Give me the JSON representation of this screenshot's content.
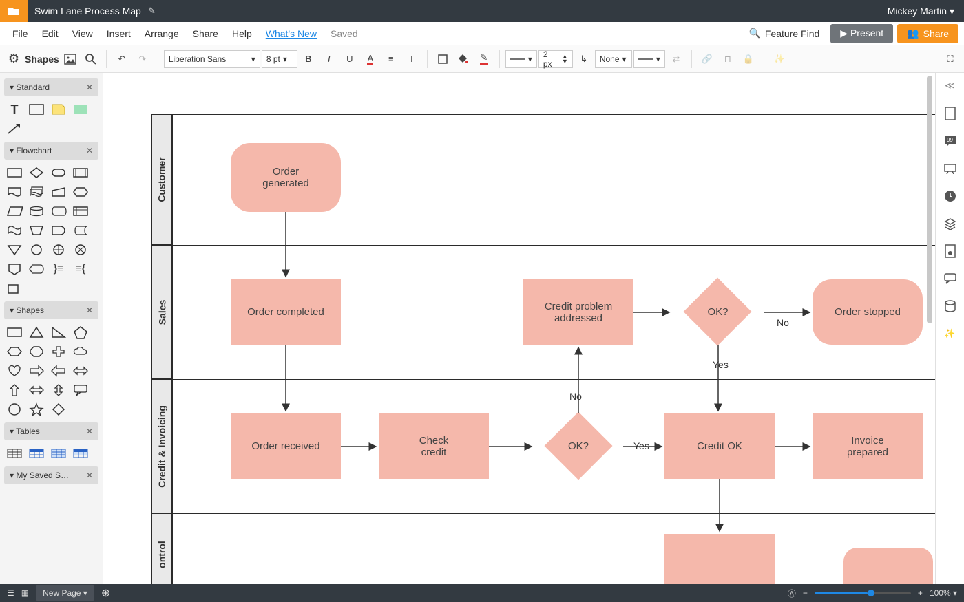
{
  "titlebar": {
    "doc_title": "Swim Lane Process Map",
    "user": "Mickey Martin ▾"
  },
  "menu": {
    "file": "File",
    "edit": "Edit",
    "view": "View",
    "insert": "Insert",
    "arrange": "Arrange",
    "share": "Share",
    "help": "Help",
    "whats_new": "What's New",
    "saved": "Saved",
    "feature_find": "Feature Find",
    "present": "▶ Present",
    "share_btn": "Share"
  },
  "toolbar": {
    "shapes": "Shapes",
    "font": "Liberation Sans",
    "font_caret": "▾",
    "size": "8 pt",
    "size_caret": "▾",
    "line_width": "2 px",
    "line_style": "None"
  },
  "panels": {
    "standard": "Standard",
    "flowchart": "Flowchart",
    "shapes": "Shapes",
    "tables": "Tables",
    "mysaved": "My Saved S…"
  },
  "status": {
    "page": "New Page ▾",
    "zoom": "100% ▾"
  },
  "diagram": {
    "lanes": {
      "customer": "Customer",
      "sales": "Sales",
      "credit": "Credit & Invoicing",
      "control": "ontrol"
    },
    "nodes": {
      "order_generated": "Order\ngenerated",
      "order_completed": "Order completed",
      "credit_problem": "Credit problem\naddressed",
      "ok1": "OK?",
      "order_stopped": "Order stopped",
      "order_received": "Order received",
      "check_credit": "Check\ncredit",
      "ok2": "OK?",
      "credit_ok": "Credit OK",
      "invoice_prepared": "Invoice\nprepared"
    },
    "labels": {
      "yes": "Yes",
      "no": "No"
    }
  }
}
